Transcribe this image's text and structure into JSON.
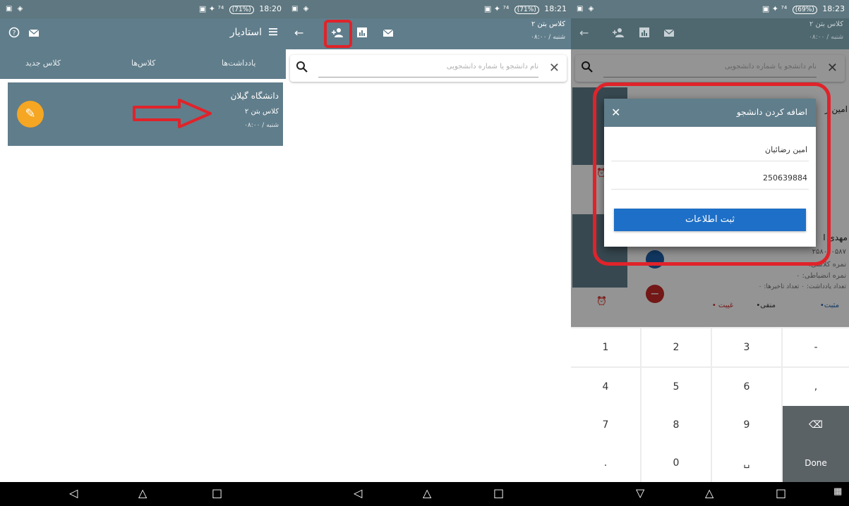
{
  "screen1": {
    "status": {
      "left_icons": "▣ ◈",
      "right_icons": "▣ ✦ ⁷⁴",
      "battery": "(71%)",
      "time": "18:20"
    },
    "app_title": "استادیار",
    "menu_icon": "menu-icon",
    "tabs": [
      "کلاس جدید",
      "کلاس‌ها",
      "یادداشت‌ها"
    ],
    "card": {
      "title": "دانشگاه گیلان",
      "subtitle": "کلاس بتن ۲",
      "schedule": "شنبه / ۰۸:۰۰"
    },
    "nav": [
      "◁",
      "△",
      "□"
    ]
  },
  "screen2": {
    "status": {
      "left_icons": "▣ ◈",
      "right_icons": "▣ ✦ ⁷⁴",
      "battery": "(71%)",
      "time": "18:21"
    },
    "class_name": "کلاس بتن ۲",
    "class_schedule": "شنبه / ۰۸:۰۰",
    "search_placeholder": "نام دانشجو یا شماره دانشجویی",
    "nav": [
      "◁",
      "△",
      "□"
    ]
  },
  "screen3": {
    "status": {
      "left_icons": "▣ ◈",
      "right_icons": "▣ ✦ ⁷⁴",
      "battery": "(69%)",
      "time": "18:23"
    },
    "class_name": "کلاس بتن ۲",
    "class_schedule": "شنبه / ۰۸:۰۰",
    "search_placeholder": "نام دانشجو یا شماره دانشجویی",
    "background_items": {
      "name1": "امین ر",
      "name2": "مهدی ا",
      "code": "۲۵۸۰۰۰۵۸۷",
      "line1": "نمره کلاسی: ۰",
      "line2": "نمره انضباطی: ۰",
      "line3": "تعداد یادداشت: ۰ تعداد تاخیرها: ۰",
      "status_present": "•مثبت",
      "status_negative": "•منفی",
      "status_absent": "• غیبت"
    },
    "dialog": {
      "title": "اضافه کردن دانشجو",
      "name_value": "امین رضائیان",
      "id_value": "250639884",
      "submit": "ثبت اطلاعات"
    },
    "keyboard": {
      "row1": [
        "1",
        "2",
        "3",
        "-"
      ],
      "row2": [
        "4",
        "5",
        "6",
        ","
      ],
      "row3": [
        "7",
        "8",
        "9",
        "⌫"
      ],
      "row4": [
        ".",
        "0",
        "␣",
        "Done"
      ]
    },
    "nav": [
      "▽",
      "△",
      "□",
      "▦"
    ]
  }
}
